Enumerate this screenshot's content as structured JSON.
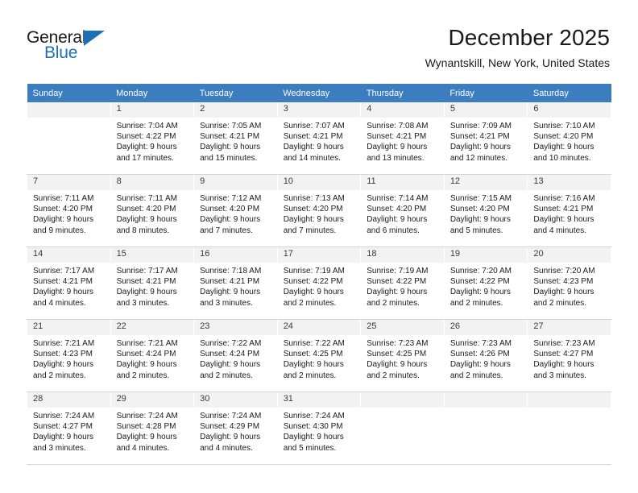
{
  "brand": {
    "name_top": "General",
    "name_bottom": "Blue",
    "accent_color": "#1f6fb5"
  },
  "header": {
    "month_title": "December 2025",
    "location": "Wynantskill, New York, United States",
    "header_bg_color": "#3b7dbf"
  },
  "calendar": {
    "weekday_headers": [
      "Sunday",
      "Monday",
      "Tuesday",
      "Wednesday",
      "Thursday",
      "Friday",
      "Saturday"
    ],
    "weeks": [
      [
        {
          "day": "",
          "sunrise": "",
          "sunset": "",
          "daylight_line1": "",
          "daylight_line2": ""
        },
        {
          "day": "1",
          "sunrise": "Sunrise: 7:04 AM",
          "sunset": "Sunset: 4:22 PM",
          "daylight_line1": "Daylight: 9 hours",
          "daylight_line2": "and 17 minutes."
        },
        {
          "day": "2",
          "sunrise": "Sunrise: 7:05 AM",
          "sunset": "Sunset: 4:21 PM",
          "daylight_line1": "Daylight: 9 hours",
          "daylight_line2": "and 15 minutes."
        },
        {
          "day": "3",
          "sunrise": "Sunrise: 7:07 AM",
          "sunset": "Sunset: 4:21 PM",
          "daylight_line1": "Daylight: 9 hours",
          "daylight_line2": "and 14 minutes."
        },
        {
          "day": "4",
          "sunrise": "Sunrise: 7:08 AM",
          "sunset": "Sunset: 4:21 PM",
          "daylight_line1": "Daylight: 9 hours",
          "daylight_line2": "and 13 minutes."
        },
        {
          "day": "5",
          "sunrise": "Sunrise: 7:09 AM",
          "sunset": "Sunset: 4:21 PM",
          "daylight_line1": "Daylight: 9 hours",
          "daylight_line2": "and 12 minutes."
        },
        {
          "day": "6",
          "sunrise": "Sunrise: 7:10 AM",
          "sunset": "Sunset: 4:20 PM",
          "daylight_line1": "Daylight: 9 hours",
          "daylight_line2": "and 10 minutes."
        }
      ],
      [
        {
          "day": "7",
          "sunrise": "Sunrise: 7:11 AM",
          "sunset": "Sunset: 4:20 PM",
          "daylight_line1": "Daylight: 9 hours",
          "daylight_line2": "and 9 minutes."
        },
        {
          "day": "8",
          "sunrise": "Sunrise: 7:11 AM",
          "sunset": "Sunset: 4:20 PM",
          "daylight_line1": "Daylight: 9 hours",
          "daylight_line2": "and 8 minutes."
        },
        {
          "day": "9",
          "sunrise": "Sunrise: 7:12 AM",
          "sunset": "Sunset: 4:20 PM",
          "daylight_line1": "Daylight: 9 hours",
          "daylight_line2": "and 7 minutes."
        },
        {
          "day": "10",
          "sunrise": "Sunrise: 7:13 AM",
          "sunset": "Sunset: 4:20 PM",
          "daylight_line1": "Daylight: 9 hours",
          "daylight_line2": "and 7 minutes."
        },
        {
          "day": "11",
          "sunrise": "Sunrise: 7:14 AM",
          "sunset": "Sunset: 4:20 PM",
          "daylight_line1": "Daylight: 9 hours",
          "daylight_line2": "and 6 minutes."
        },
        {
          "day": "12",
          "sunrise": "Sunrise: 7:15 AM",
          "sunset": "Sunset: 4:20 PM",
          "daylight_line1": "Daylight: 9 hours",
          "daylight_line2": "and 5 minutes."
        },
        {
          "day": "13",
          "sunrise": "Sunrise: 7:16 AM",
          "sunset": "Sunset: 4:21 PM",
          "daylight_line1": "Daylight: 9 hours",
          "daylight_line2": "and 4 minutes."
        }
      ],
      [
        {
          "day": "14",
          "sunrise": "Sunrise: 7:17 AM",
          "sunset": "Sunset: 4:21 PM",
          "daylight_line1": "Daylight: 9 hours",
          "daylight_line2": "and 4 minutes."
        },
        {
          "day": "15",
          "sunrise": "Sunrise: 7:17 AM",
          "sunset": "Sunset: 4:21 PM",
          "daylight_line1": "Daylight: 9 hours",
          "daylight_line2": "and 3 minutes."
        },
        {
          "day": "16",
          "sunrise": "Sunrise: 7:18 AM",
          "sunset": "Sunset: 4:21 PM",
          "daylight_line1": "Daylight: 9 hours",
          "daylight_line2": "and 3 minutes."
        },
        {
          "day": "17",
          "sunrise": "Sunrise: 7:19 AM",
          "sunset": "Sunset: 4:22 PM",
          "daylight_line1": "Daylight: 9 hours",
          "daylight_line2": "and 2 minutes."
        },
        {
          "day": "18",
          "sunrise": "Sunrise: 7:19 AM",
          "sunset": "Sunset: 4:22 PM",
          "daylight_line1": "Daylight: 9 hours",
          "daylight_line2": "and 2 minutes."
        },
        {
          "day": "19",
          "sunrise": "Sunrise: 7:20 AM",
          "sunset": "Sunset: 4:22 PM",
          "daylight_line1": "Daylight: 9 hours",
          "daylight_line2": "and 2 minutes."
        },
        {
          "day": "20",
          "sunrise": "Sunrise: 7:20 AM",
          "sunset": "Sunset: 4:23 PM",
          "daylight_line1": "Daylight: 9 hours",
          "daylight_line2": "and 2 minutes."
        }
      ],
      [
        {
          "day": "21",
          "sunrise": "Sunrise: 7:21 AM",
          "sunset": "Sunset: 4:23 PM",
          "daylight_line1": "Daylight: 9 hours",
          "daylight_line2": "and 2 minutes."
        },
        {
          "day": "22",
          "sunrise": "Sunrise: 7:21 AM",
          "sunset": "Sunset: 4:24 PM",
          "daylight_line1": "Daylight: 9 hours",
          "daylight_line2": "and 2 minutes."
        },
        {
          "day": "23",
          "sunrise": "Sunrise: 7:22 AM",
          "sunset": "Sunset: 4:24 PM",
          "daylight_line1": "Daylight: 9 hours",
          "daylight_line2": "and 2 minutes."
        },
        {
          "day": "24",
          "sunrise": "Sunrise: 7:22 AM",
          "sunset": "Sunset: 4:25 PM",
          "daylight_line1": "Daylight: 9 hours",
          "daylight_line2": "and 2 minutes."
        },
        {
          "day": "25",
          "sunrise": "Sunrise: 7:23 AM",
          "sunset": "Sunset: 4:25 PM",
          "daylight_line1": "Daylight: 9 hours",
          "daylight_line2": "and 2 minutes."
        },
        {
          "day": "26",
          "sunrise": "Sunrise: 7:23 AM",
          "sunset": "Sunset: 4:26 PM",
          "daylight_line1": "Daylight: 9 hours",
          "daylight_line2": "and 2 minutes."
        },
        {
          "day": "27",
          "sunrise": "Sunrise: 7:23 AM",
          "sunset": "Sunset: 4:27 PM",
          "daylight_line1": "Daylight: 9 hours",
          "daylight_line2": "and 3 minutes."
        }
      ],
      [
        {
          "day": "28",
          "sunrise": "Sunrise: 7:24 AM",
          "sunset": "Sunset: 4:27 PM",
          "daylight_line1": "Daylight: 9 hours",
          "daylight_line2": "and 3 minutes."
        },
        {
          "day": "29",
          "sunrise": "Sunrise: 7:24 AM",
          "sunset": "Sunset: 4:28 PM",
          "daylight_line1": "Daylight: 9 hours",
          "daylight_line2": "and 4 minutes."
        },
        {
          "day": "30",
          "sunrise": "Sunrise: 7:24 AM",
          "sunset": "Sunset: 4:29 PM",
          "daylight_line1": "Daylight: 9 hours",
          "daylight_line2": "and 4 minutes."
        },
        {
          "day": "31",
          "sunrise": "Sunrise: 7:24 AM",
          "sunset": "Sunset: 4:30 PM",
          "daylight_line1": "Daylight: 9 hours",
          "daylight_line2": "and 5 minutes."
        },
        {
          "day": "",
          "sunrise": "",
          "sunset": "",
          "daylight_line1": "",
          "daylight_line2": ""
        },
        {
          "day": "",
          "sunrise": "",
          "sunset": "",
          "daylight_line1": "",
          "daylight_line2": ""
        },
        {
          "day": "",
          "sunrise": "",
          "sunset": "",
          "daylight_line1": "",
          "daylight_line2": ""
        }
      ]
    ]
  }
}
